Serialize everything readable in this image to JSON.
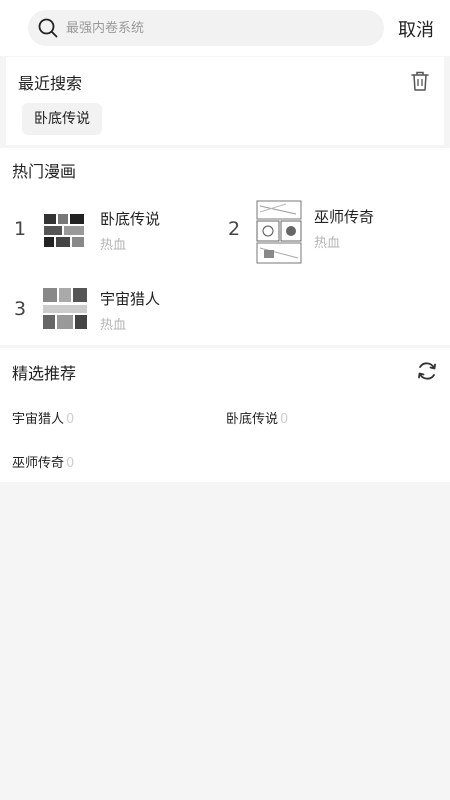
{
  "search": {
    "placeholder": "最强内卷系统",
    "cancel_label": "取消"
  },
  "recent": {
    "title": "最近搜索",
    "items": [
      "卧底传说"
    ]
  },
  "hot": {
    "title": "热门漫画",
    "items": [
      {
        "rank": "1",
        "title": "卧底传说",
        "tag": "热血"
      },
      {
        "rank": "2",
        "title": "巫师传奇",
        "tag": "热血"
      },
      {
        "rank": "3",
        "title": "宇宙猎人",
        "tag": "热血"
      }
    ]
  },
  "picks": {
    "title": "精选推荐",
    "items": [
      {
        "title": "宇宙猎人",
        "count": "0"
      },
      {
        "title": "卧底传说",
        "count": "0"
      },
      {
        "title": "巫师传奇",
        "count": "0"
      }
    ]
  }
}
